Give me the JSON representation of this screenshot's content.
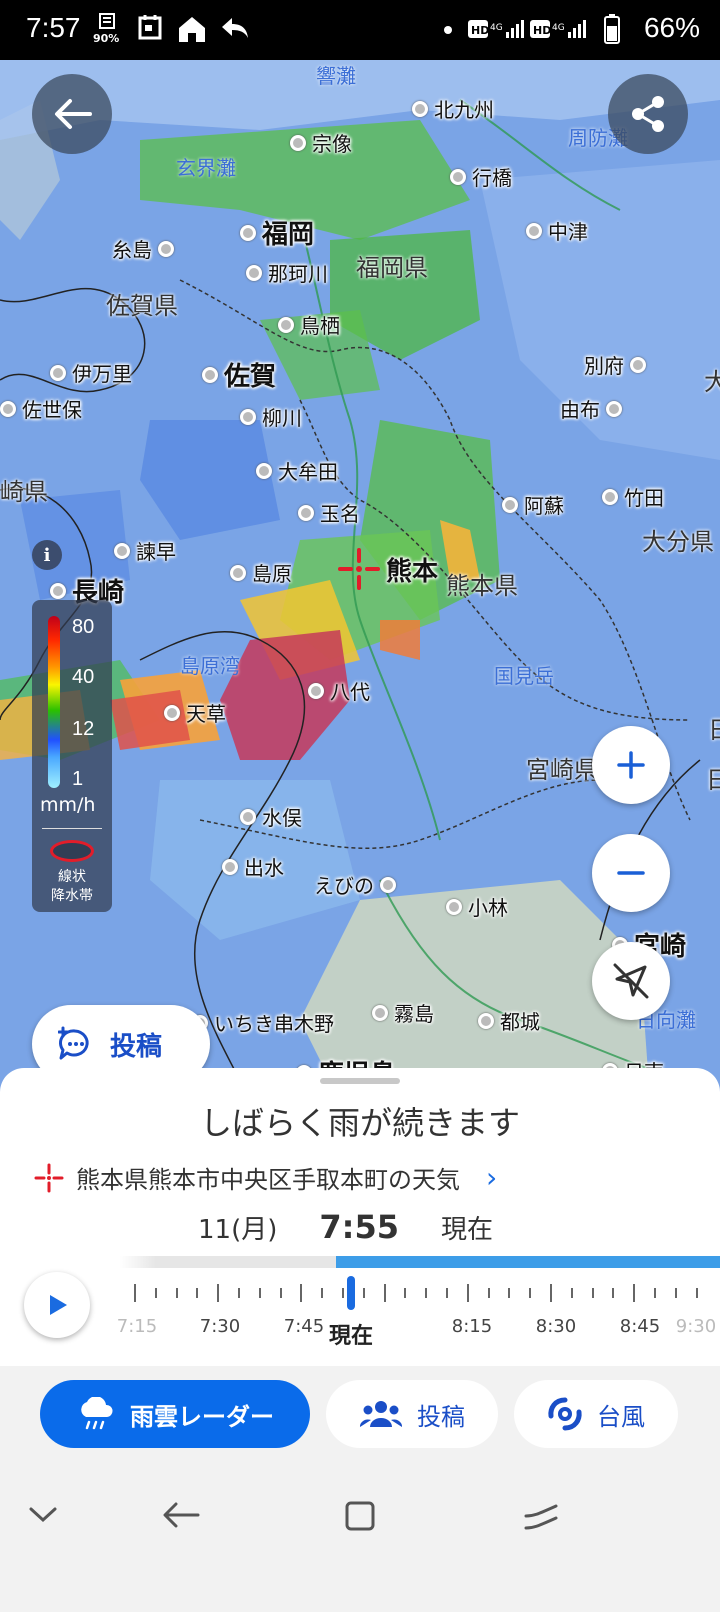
{
  "status_bar": {
    "time": "7:57",
    "data_saver": "90%",
    "network_1": "HD 4G",
    "network_2": "HD 4G",
    "battery": "66%"
  },
  "map": {
    "cities": [
      {
        "name": "北九州"
      },
      {
        "name": "宗像"
      },
      {
        "name": "行橋"
      },
      {
        "name": "中津"
      },
      {
        "name": "糸島"
      },
      {
        "name": "福岡"
      },
      {
        "name": "那珂川"
      },
      {
        "name": "鳥栖"
      },
      {
        "name": "伊万里"
      },
      {
        "name": "佐賀"
      },
      {
        "name": "別府"
      },
      {
        "name": "佐世保"
      },
      {
        "name": "柳川"
      },
      {
        "name": "由布"
      },
      {
        "name": "大牟田"
      },
      {
        "name": "玉名"
      },
      {
        "name": "阿蘇"
      },
      {
        "name": "竹田"
      },
      {
        "name": "諫早"
      },
      {
        "name": "長崎"
      },
      {
        "name": "島原"
      },
      {
        "name": "熊本"
      },
      {
        "name": "八代"
      },
      {
        "name": "天草"
      },
      {
        "name": "水俣"
      },
      {
        "name": "出水"
      },
      {
        "name": "えびの"
      },
      {
        "name": "小林"
      },
      {
        "name": "宮崎"
      },
      {
        "name": "いちき串木野"
      },
      {
        "name": "霧島"
      },
      {
        "name": "都城"
      },
      {
        "name": "鹿児島"
      },
      {
        "name": "日南"
      }
    ],
    "prefectures": [
      "福岡県",
      "佐賀県",
      "熊本県",
      "大分県",
      "宮崎県",
      "崎県"
    ],
    "seas": [
      "響灘",
      "玄界灘",
      "周防灘",
      "島原湾",
      "国見岳",
      "日向灘"
    ],
    "edge_labels": [
      "大",
      "日",
      "日"
    ],
    "legend": {
      "values": [
        "80",
        "40",
        "12",
        "1"
      ],
      "unit": "mm/h",
      "linear_label_1": "線状",
      "linear_label_2": "降水帯"
    },
    "post_button": "投稿"
  },
  "sheet": {
    "headline": "しばらく雨が続きます",
    "location": "熊本県熊本市中央区手取本町の天気",
    "date": "11(月)",
    "time": "7:55",
    "now_suffix": "現在"
  },
  "timeline": {
    "labels": [
      "7:15",
      "7:30",
      "7:45",
      "8:15",
      "8:30",
      "8:45",
      "9:30"
    ],
    "now_label": "現在"
  },
  "tabs": [
    {
      "label": "雨雲レーダー",
      "active": true
    },
    {
      "label": "投稿",
      "active": false
    },
    {
      "label": "台風",
      "active": false
    }
  ],
  "colors": {
    "accent": "#0a6bea",
    "marker": "#e21d2a"
  }
}
